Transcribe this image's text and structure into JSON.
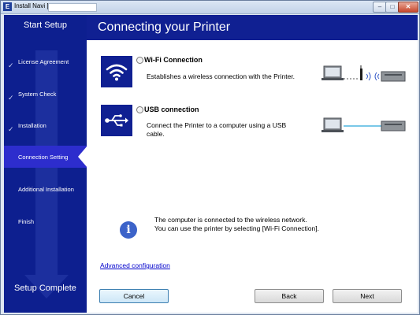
{
  "window": {
    "title": "Install Navi [",
    "app_icon_letter": "E",
    "minimize_glyph": "–",
    "maximize_glyph": "□",
    "close_glyph": "✕"
  },
  "sidebar": {
    "start_label": "Start Setup",
    "complete_label": "Setup Complete",
    "steps": [
      {
        "label": "License Agreement",
        "done": true
      },
      {
        "label": "System Check",
        "done": true
      },
      {
        "label": "Installation",
        "done": true
      },
      {
        "label": "Connection Setting",
        "active": true
      },
      {
        "label": "Additional Installation"
      },
      {
        "label": "Finish"
      }
    ],
    "check_glyph": "✓"
  },
  "header": {
    "title": "Connecting your Printer"
  },
  "options": [
    {
      "title": "Wi-Fi Connection",
      "description": "Establishes a wireless connection with the Printer.",
      "icon": "wifi-icon"
    },
    {
      "title": "USB connection",
      "description_line1": "Connect the Printer to a computer using a USB",
      "description_line2": "cable.",
      "icon": "usb-icon"
    }
  ],
  "info": {
    "line1": "The computer is connected to the wireless network.",
    "line2": "You can use the printer by selecting [Wi-Fi Connection].",
    "icon": "info-icon",
    "glyph": "i"
  },
  "advanced_link": "Advanced configuration",
  "buttons": {
    "cancel": "Cancel",
    "back": "Back",
    "next": "Next"
  },
  "colors": {
    "sidebar": "#0d1f8f",
    "header": "#102092",
    "active_step": "#2d2dcd"
  }
}
